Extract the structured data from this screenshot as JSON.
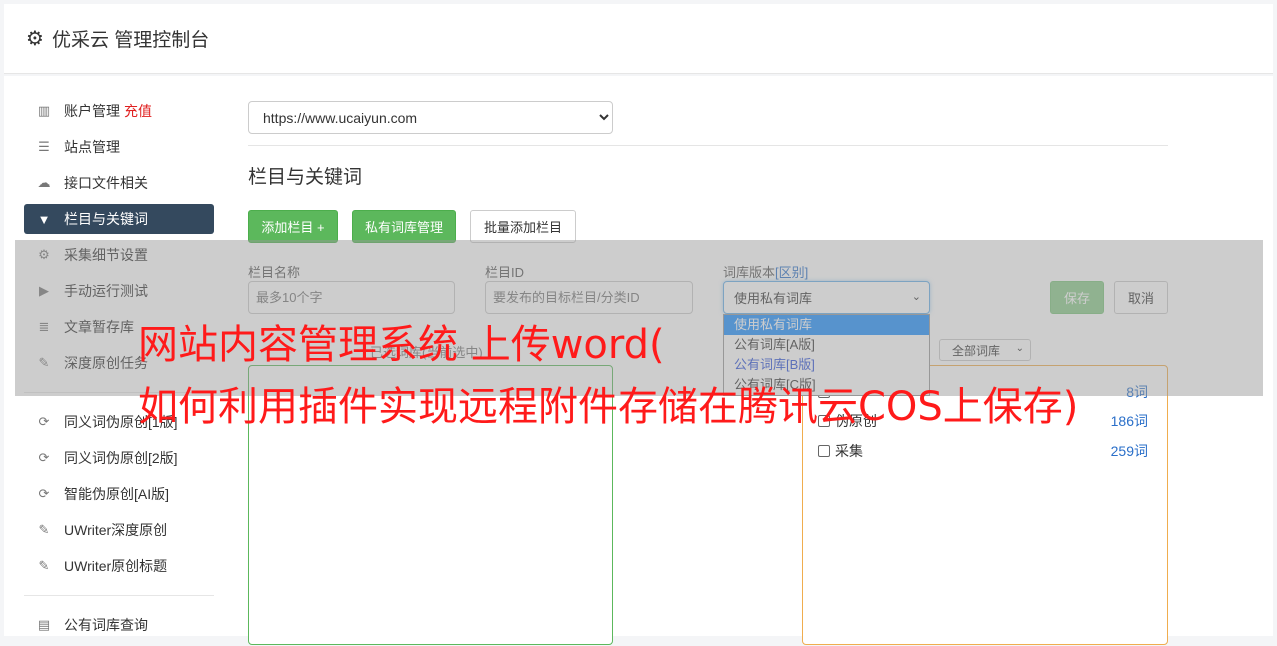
{
  "header": {
    "title": "优采云 管理控制台",
    "icon": "gear-icon"
  },
  "sidebar": {
    "items": [
      {
        "label": "账户管理",
        "badge": "充值",
        "icon": "bar-chart-icon"
      },
      {
        "label": "站点管理",
        "icon": "server-icon"
      },
      {
        "label": "接口文件相关",
        "icon": "cloud-upload-icon"
      },
      {
        "label": "栏目与关键词",
        "icon": "filter-icon",
        "active": true
      },
      {
        "label": "采集细节设置",
        "icon": "gears-icon"
      },
      {
        "label": "手动运行测试",
        "icon": "play-circle-icon"
      },
      {
        "label": "文章暂存库",
        "icon": "database-icon"
      },
      {
        "label": "深度原创任务",
        "icon": "edit-icon"
      },
      {
        "label": "同义词伪原创[1版]",
        "icon": "refresh-icon"
      },
      {
        "label": "同义词伪原创[2版]",
        "icon": "refresh-icon"
      },
      {
        "label": "智能伪原创[AI版]",
        "icon": "refresh-icon"
      },
      {
        "label": "UWriter深度原创",
        "icon": "edit-icon"
      },
      {
        "label": "UWriter原创标题",
        "icon": "edit-icon"
      },
      {
        "label": "公有词库查询",
        "icon": "book-icon"
      }
    ]
  },
  "site": {
    "selected": "https://www.ucaiyun.com"
  },
  "section": {
    "title": "栏目与关键词"
  },
  "buttons": {
    "add_column": "添加栏目 +",
    "private_lib": "私有词库管理",
    "batch_add": "批量添加栏目",
    "save": "保存",
    "cancel": "取消"
  },
  "form": {
    "name_label": "栏目名称",
    "name_placeholder": "最多10个字",
    "id_label": "栏目ID",
    "id_placeholder": "要发布的目标栏目/分类ID",
    "version_label": "词库版本",
    "version_diff": "[区别]",
    "version_selected": "使用私有词库",
    "version_options": [
      "使用私有词库",
      "公有词库[A版]",
      "公有词库[B版]",
      "公有词库[C版]"
    ]
  },
  "libraries": {
    "left_caption": "已选词库(当前选中)",
    "filter_selected": "全部词库",
    "rows": [
      {
        "name": "",
        "count": "8词"
      },
      {
        "name": "伪原创",
        "count": "186词"
      },
      {
        "name": "采集",
        "count": "259词"
      }
    ]
  },
  "watermark": {
    "line1": "网站内容管理系统 上传word(",
    "line2": "如何利用插件实现远程附件存储在腾讯云COS上保存)"
  }
}
